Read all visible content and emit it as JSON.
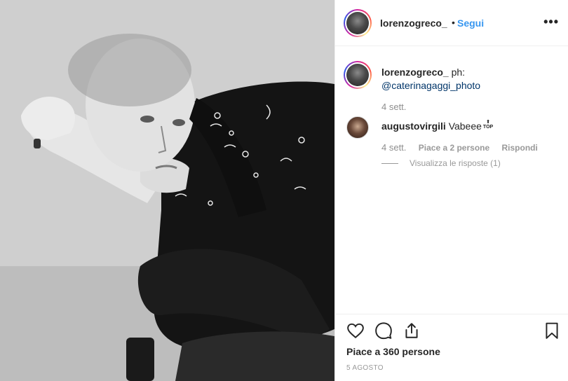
{
  "post": {
    "author": "lorenzogreco_",
    "follow_label": "Segui",
    "dot": "•",
    "more": "•••"
  },
  "caption": {
    "author": "lorenzogreco_",
    "text": " ph:",
    "mention": "@caterinagaggi_photo",
    "time": "4 sett."
  },
  "comment": {
    "author": "augustovirgili",
    "text": "Vabeee",
    "badge": "TOP",
    "time": "4 sett.",
    "likes": "Piace a 2 persone",
    "reply": "Rispondi",
    "view_replies": "Visualizza le risposte (1)"
  },
  "footer": {
    "likes": "Piace a 360 persone",
    "date": "5 AGOSTO"
  },
  "icons": {
    "like": "heart-icon",
    "comment": "comment-icon",
    "share": "share-icon",
    "save": "bookmark-icon"
  }
}
